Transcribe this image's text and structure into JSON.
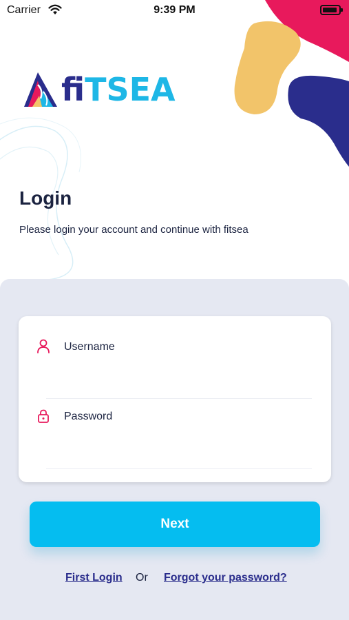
{
  "status_bar": {
    "carrier": "Carrier",
    "time": "9:39 PM"
  },
  "brand": {
    "logo_text_prefix": "fi",
    "logo_text_suffix": "TSEA",
    "colors": {
      "navy": "#2a2d8c",
      "cyan": "#1eb7e6",
      "pink": "#e8195c",
      "yellow": "#f2c46a"
    }
  },
  "header": {
    "title": "Login",
    "subtitle": "Please login your account and continue with fitsea"
  },
  "form": {
    "username": {
      "label": "Username",
      "value": "",
      "icon": "user-icon"
    },
    "password": {
      "label": "Password",
      "value": "",
      "icon": "lock-icon"
    }
  },
  "actions": {
    "next_label": "Next",
    "first_login": "First Login",
    "or_text": "Or",
    "forgot_password": "Forgot your password?"
  },
  "colors": {
    "panel_bg": "#e5e8f2",
    "button_bg": "#05bdf0",
    "text": "#1b2340"
  }
}
